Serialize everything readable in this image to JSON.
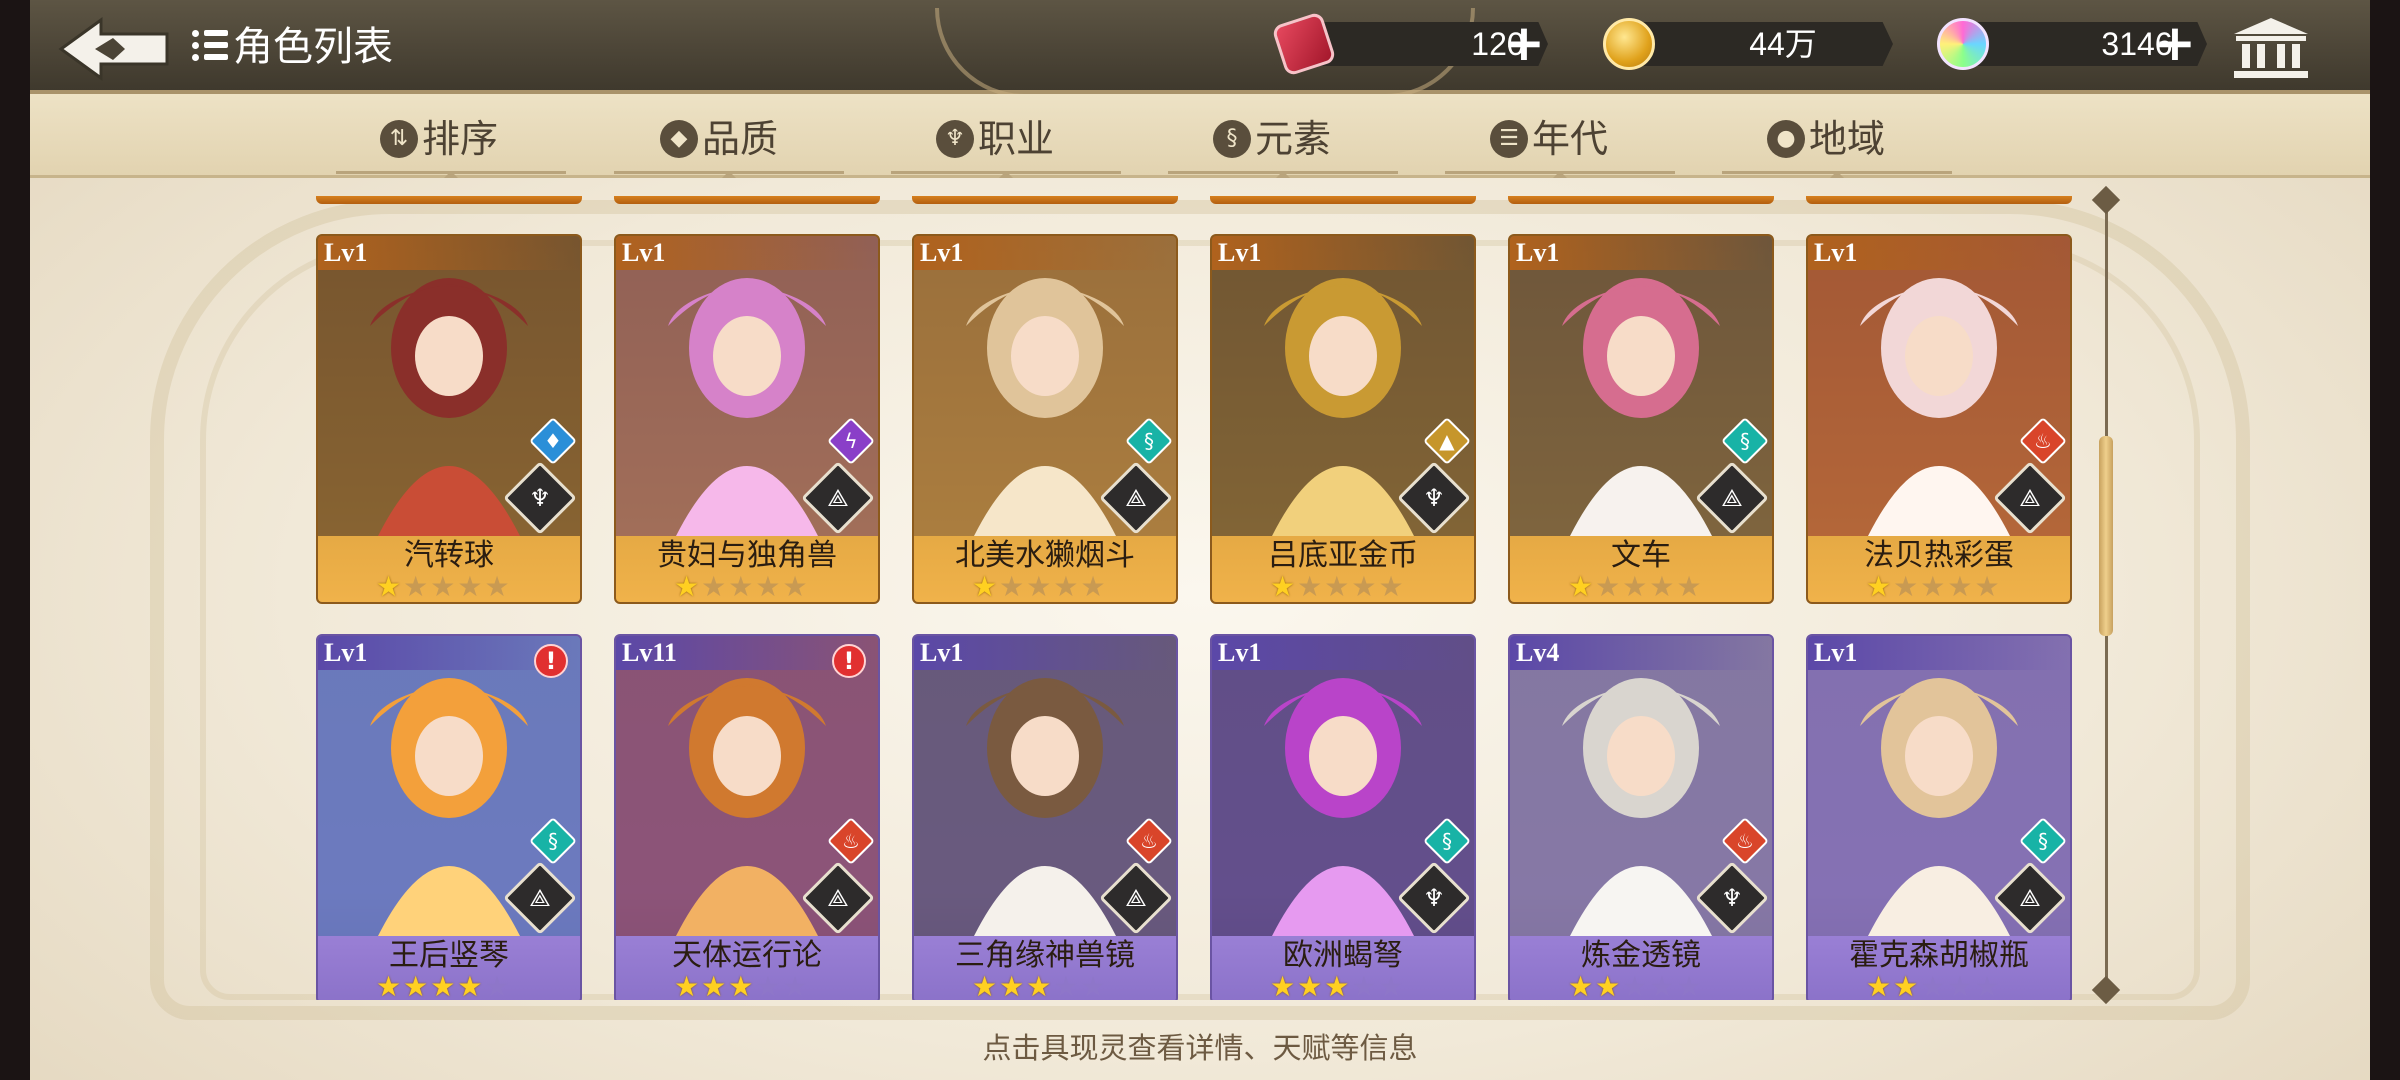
{
  "header": {
    "title": "角色列表",
    "currencies": [
      {
        "name": "ticket",
        "icon": "ticket-icon",
        "value": "120",
        "has_plus": true
      },
      {
        "name": "gold",
        "icon": "gold-coin-icon",
        "value": "44万",
        "has_plus": false
      },
      {
        "name": "gem",
        "icon": "rainbow-gem-icon",
        "value": "3146",
        "has_plus": true
      }
    ],
    "plus_glyph": "+"
  },
  "filters": {
    "tabs": [
      {
        "label": "排序",
        "icon": "sort-icon",
        "glyph": "⇅"
      },
      {
        "label": "品质",
        "icon": "quality-icon",
        "glyph": "◆"
      },
      {
        "label": "职业",
        "icon": "class-icon",
        "glyph": "♆"
      },
      {
        "label": "元素",
        "icon": "element-icon",
        "glyph": "§"
      },
      {
        "label": "年代",
        "icon": "era-icon",
        "glyph": "☰"
      },
      {
        "label": "地域",
        "icon": "region-icon",
        "glyph": "●"
      }
    ]
  },
  "cards": [
    {
      "level": "Lv1",
      "name": "汽转球",
      "stars": 1,
      "max_stars": 5,
      "rarity": "gold",
      "element": "water",
      "element_glyph": "♦",
      "element_color": "#2b8fd8",
      "job_glyph": "♆",
      "alert": false
    },
    {
      "level": "Lv1",
      "name": "贵妇与独角兽",
      "stars": 1,
      "max_stars": 5,
      "rarity": "gold",
      "element": "thunder",
      "element_glyph": "ϟ",
      "element_color": "#8a3fc8",
      "job_glyph": "⟁",
      "alert": false
    },
    {
      "level": "Lv1",
      "name": "北美水獭烟斗",
      "stars": 1,
      "max_stars": 5,
      "rarity": "gold",
      "element": "wind",
      "element_glyph": "§",
      "element_color": "#18b3a6",
      "job_glyph": "⟁",
      "alert": false
    },
    {
      "level": "Lv1",
      "name": "吕底亚金币",
      "stars": 1,
      "max_stars": 5,
      "rarity": "gold",
      "element": "earth",
      "element_glyph": "▲",
      "element_color": "#c6962b",
      "job_glyph": "♆",
      "alert": false
    },
    {
      "level": "Lv1",
      "name": "文车",
      "stars": 1,
      "max_stars": 5,
      "rarity": "gold",
      "element": "wind",
      "element_glyph": "§",
      "element_color": "#18b3a6",
      "job_glyph": "⟁",
      "alert": false
    },
    {
      "level": "Lv1",
      "name": "法贝热彩蛋",
      "stars": 1,
      "max_stars": 5,
      "rarity": "gold",
      "element": "fire",
      "element_glyph": "♨",
      "element_color": "#d9452a",
      "job_glyph": "⟁",
      "alert": false
    },
    {
      "level": "Lv1",
      "name": "王后竖琴",
      "stars": 4,
      "max_stars": 5,
      "rarity": "purple",
      "element": "wind",
      "element_glyph": "§",
      "element_color": "#18b3a6",
      "job_glyph": "⟁",
      "alert": true
    },
    {
      "level": "Lv11",
      "name": "天体运行论",
      "stars": 3,
      "max_stars": 5,
      "rarity": "purple",
      "element": "fire",
      "element_glyph": "♨",
      "element_color": "#d9452a",
      "job_glyph": "⟁",
      "alert": true
    },
    {
      "level": "Lv1",
      "name": "三角缘神兽镜",
      "stars": 3,
      "max_stars": 5,
      "rarity": "purple",
      "element": "fire",
      "element_glyph": "♨",
      "element_color": "#d9452a",
      "job_glyph": "⟁",
      "alert": false
    },
    {
      "level": "Lv1",
      "name": "欧洲蝎弩",
      "stars": 3,
      "max_stars": 5,
      "rarity": "purple",
      "element": "wind",
      "element_glyph": "§",
      "element_color": "#18b3a6",
      "job_glyph": "♆",
      "alert": false
    },
    {
      "level": "Lv4",
      "name": "炼金透镜",
      "stars": 2,
      "max_stars": 5,
      "rarity": "purple",
      "element": "fire",
      "element_glyph": "♨",
      "element_color": "#d9452a",
      "job_glyph": "♆",
      "alert": false
    },
    {
      "level": "Lv1",
      "name": "霍克森胡椒瓶",
      "stars": 2,
      "max_stars": 5,
      "rarity": "purple",
      "element": "wind",
      "element_glyph": "§",
      "element_color": "#18b3a6",
      "job_glyph": "⟁",
      "alert": false
    }
  ],
  "alert_glyph": "!",
  "star_glyph": "★",
  "footer": {
    "hint": "点击具现灵查看详情、天赋等信息"
  }
}
